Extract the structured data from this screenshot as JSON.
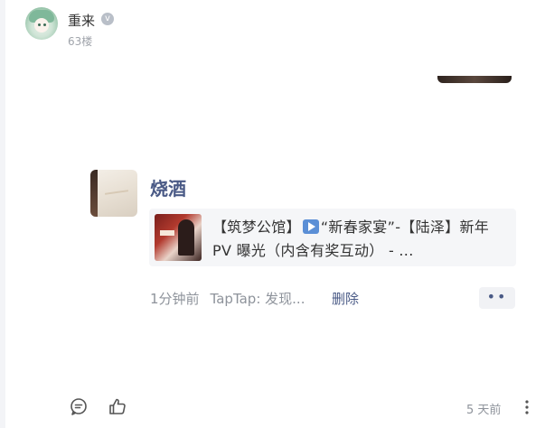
{
  "post": {
    "username": "重来",
    "verify_badge": "v",
    "floor": "63楼"
  },
  "reply": {
    "author": "烧酒",
    "share": {
      "title_part1": "【筑梦公馆】",
      "title_part2": "“新春家宴”-【陆泽】新年 PV 曝光（内含有奖互动） - ...",
      "play_icon": "play-icon"
    },
    "time": "1分钟前",
    "source": "TapTap: 发现...",
    "delete_label": "删除",
    "more_label": "••"
  },
  "footer": {
    "time": "5 天前"
  },
  "colors": {
    "link": "#4a5a86",
    "meta": "#8e939b",
    "card_bg": "#f5f6f8"
  }
}
